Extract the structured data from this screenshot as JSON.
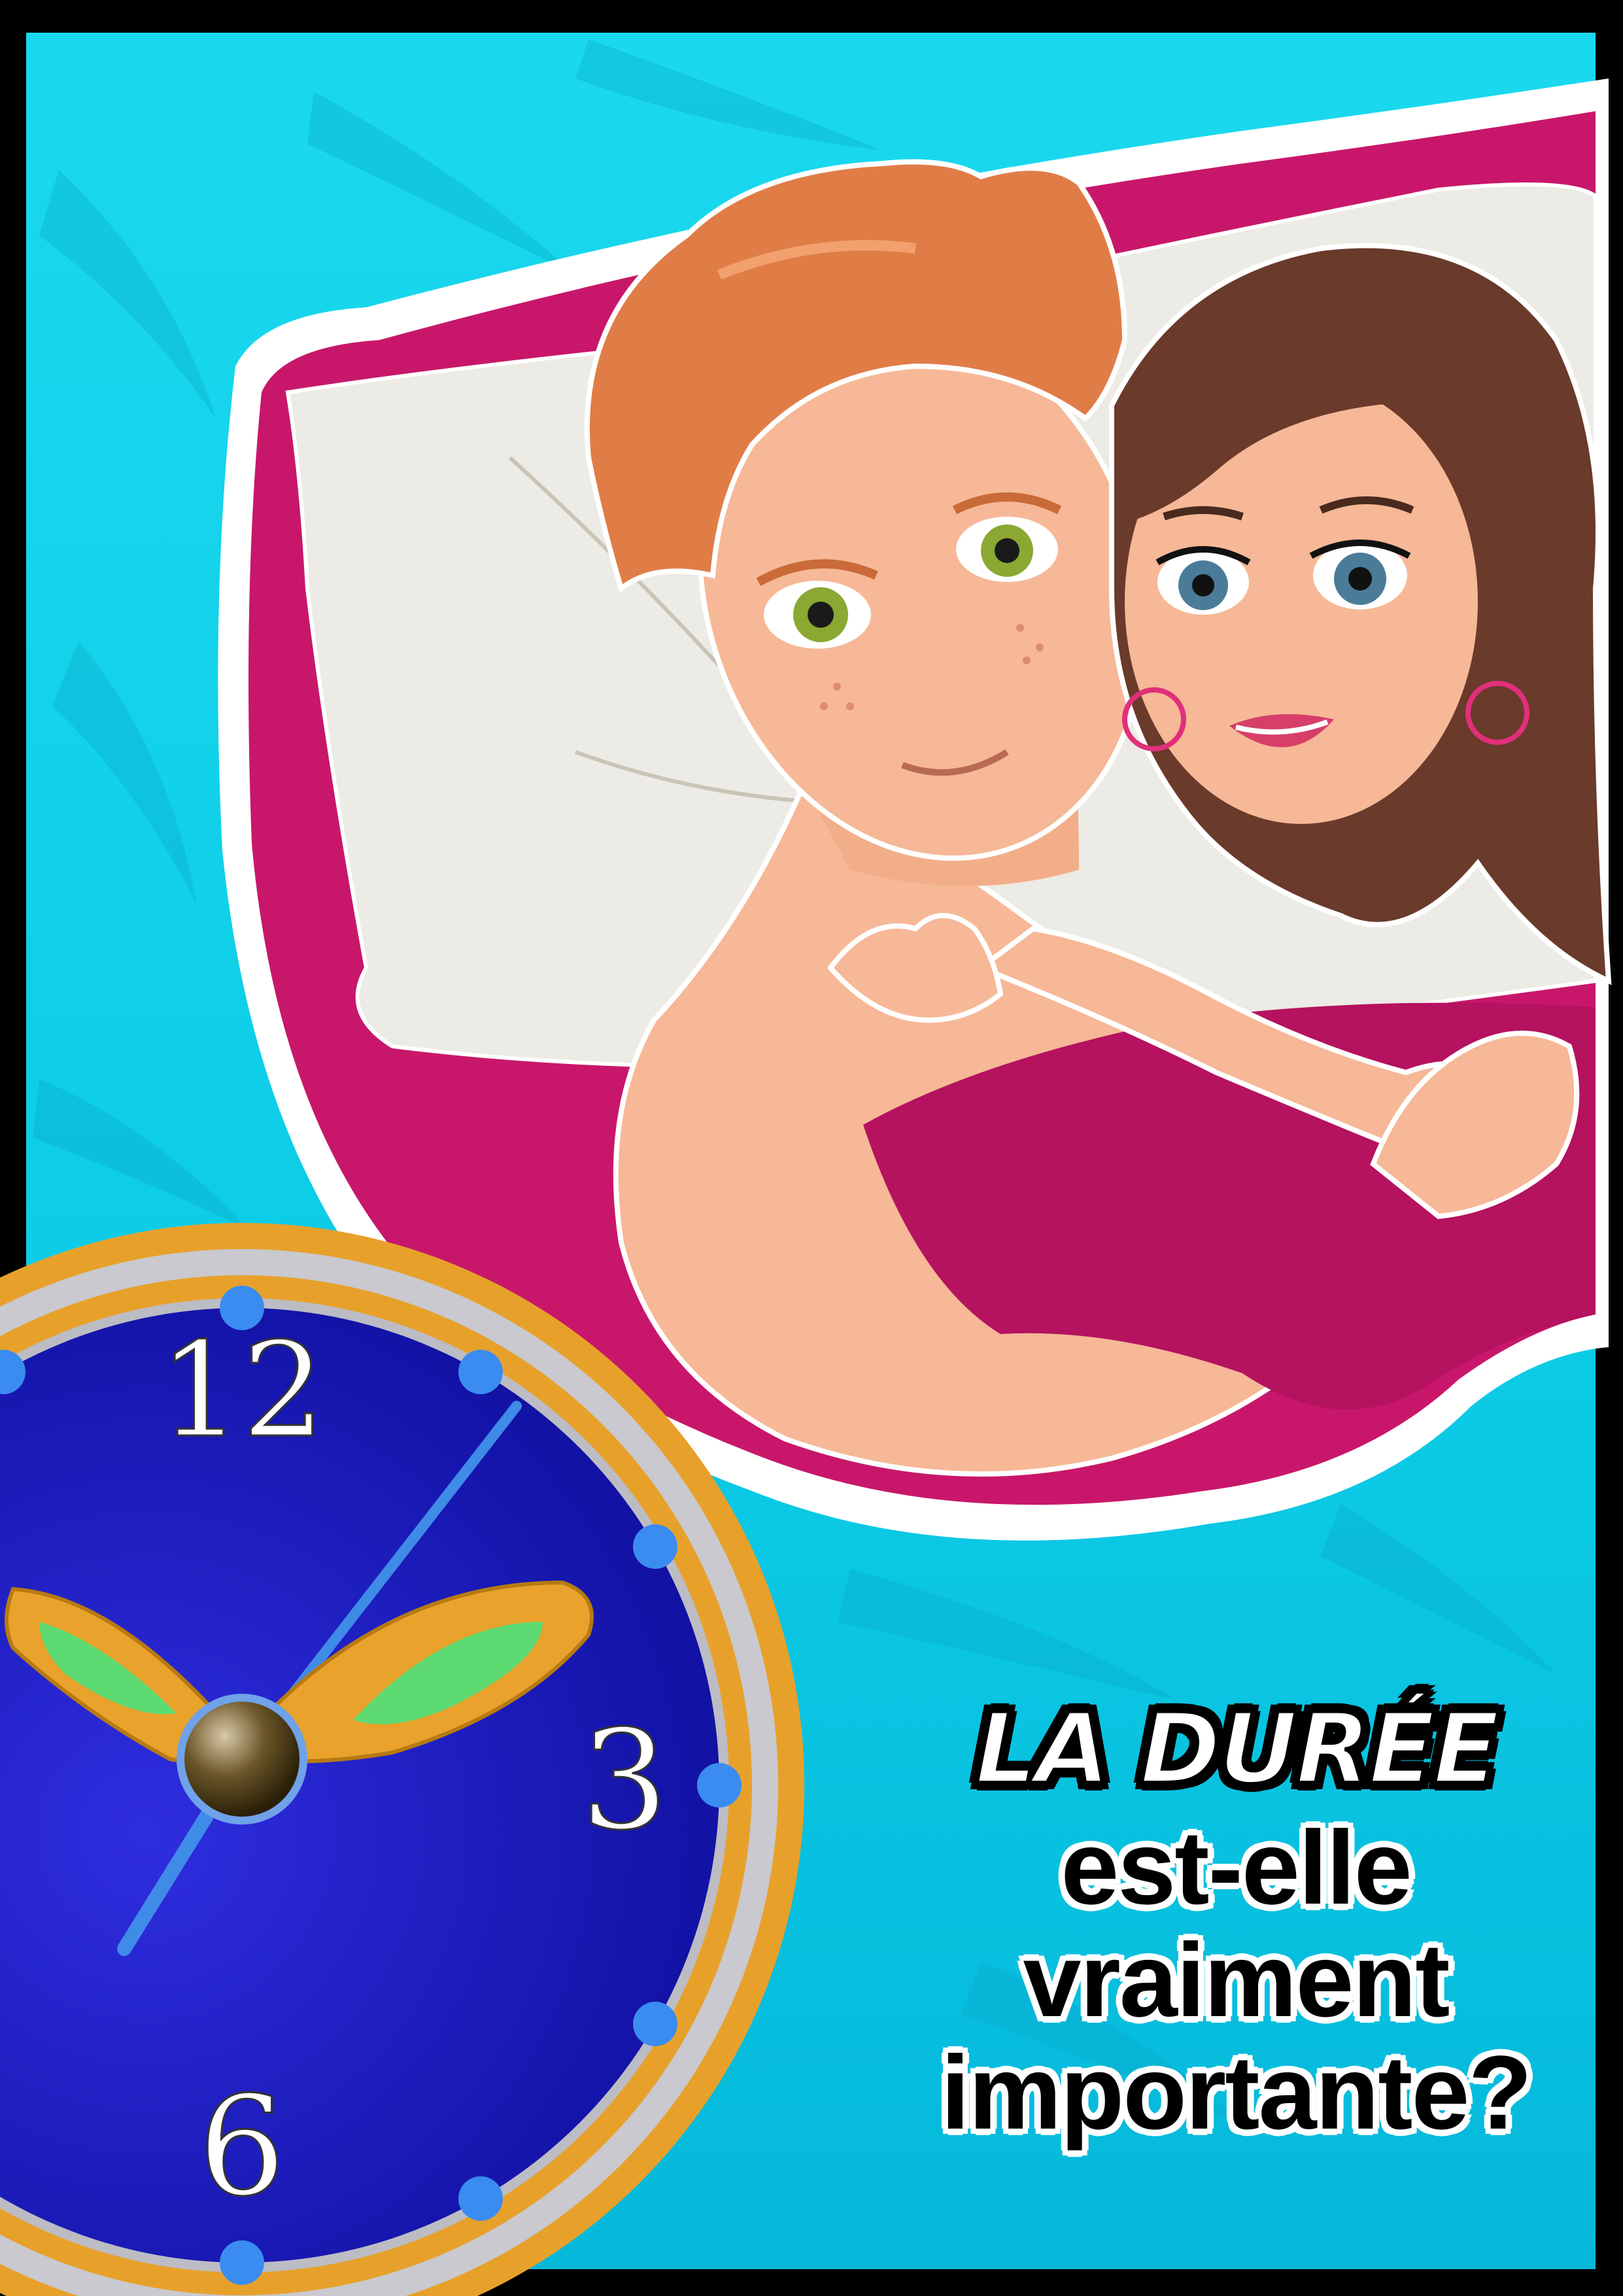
{
  "headline": {
    "title": "LA DURÉE",
    "line1": "est-elle",
    "line2": "vraiment",
    "line3": "importante?"
  },
  "clock": {
    "numerals": {
      "twelve": "12",
      "three": "3",
      "six": "6"
    }
  },
  "colors": {
    "frame": "#000000",
    "background": "#12d6ec",
    "sheet": "#c8176a",
    "pillow": "#ecebe5",
    "clock_face": "#1f1cc4",
    "clock_rim": "#e7a12b",
    "clock_dots": "#3a8cf0",
    "hand": "#3f8be8",
    "bell": "#e9a22b",
    "bell_glow": "#4fe07a",
    "skin": "#f6b896",
    "man_hair": "#e07d47",
    "woman_hair": "#6a3a2b"
  },
  "icons": {
    "illustration": "couple-in-bed-illustration",
    "clock": "alarm-clock-icon"
  }
}
